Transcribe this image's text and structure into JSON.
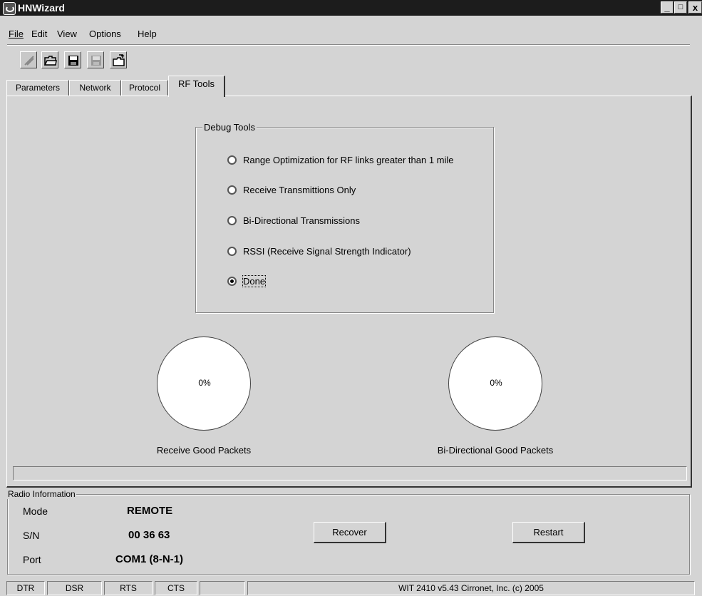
{
  "window": {
    "title": "HNWizard",
    "minimize": "_",
    "maximize": "□",
    "close": "x"
  },
  "menu": [
    "File",
    "Edit",
    "View",
    "Options",
    "Help"
  ],
  "menu_mnemonics": [
    "F",
    "E",
    "V",
    "O",
    "H"
  ],
  "toolbar": {
    "icons": [
      "connect-icon",
      "open-folder-icon",
      "save-disk-icon",
      "disabled-save-icon",
      "open-file-icon"
    ]
  },
  "tabs": [
    "Parameters",
    "Network",
    "Protocol",
    "RF Tools"
  ],
  "active_tab": "RF Tools",
  "debug_tools": {
    "legend": "Debug Tools",
    "options": [
      {
        "label": "Range Optimization for RF links greater than 1 mile",
        "checked": false
      },
      {
        "label": "Receive Transmittions Only",
        "checked": false
      },
      {
        "label": "Bi-Directional Transmissions",
        "checked": false
      },
      {
        "label": "RSSI (Receive Signal Strength Indicator)",
        "checked": false
      },
      {
        "label": "Done",
        "checked": true
      }
    ]
  },
  "gauges": [
    {
      "value_text": "0%",
      "label": "Receive Good Packets"
    },
    {
      "value_text": "0%",
      "label": "Bi-Directional Good Packets"
    }
  ],
  "radio_info": {
    "legend": "Radio Information",
    "rows": [
      {
        "key": "Mode",
        "value": "REMOTE"
      },
      {
        "key": "S/N",
        "value": "00 36 63"
      },
      {
        "key": "Port",
        "value": "COM1 (8-N-1)"
      }
    ],
    "recover_label": "Recover",
    "restart_label": "Restart"
  },
  "status_bar": {
    "cells": [
      "DTR",
      "DSR",
      "RTS",
      "CTS",
      "",
      ""
    ],
    "info": "WIT 2410 v5.43 Cirronet, Inc. (c) 2005"
  }
}
